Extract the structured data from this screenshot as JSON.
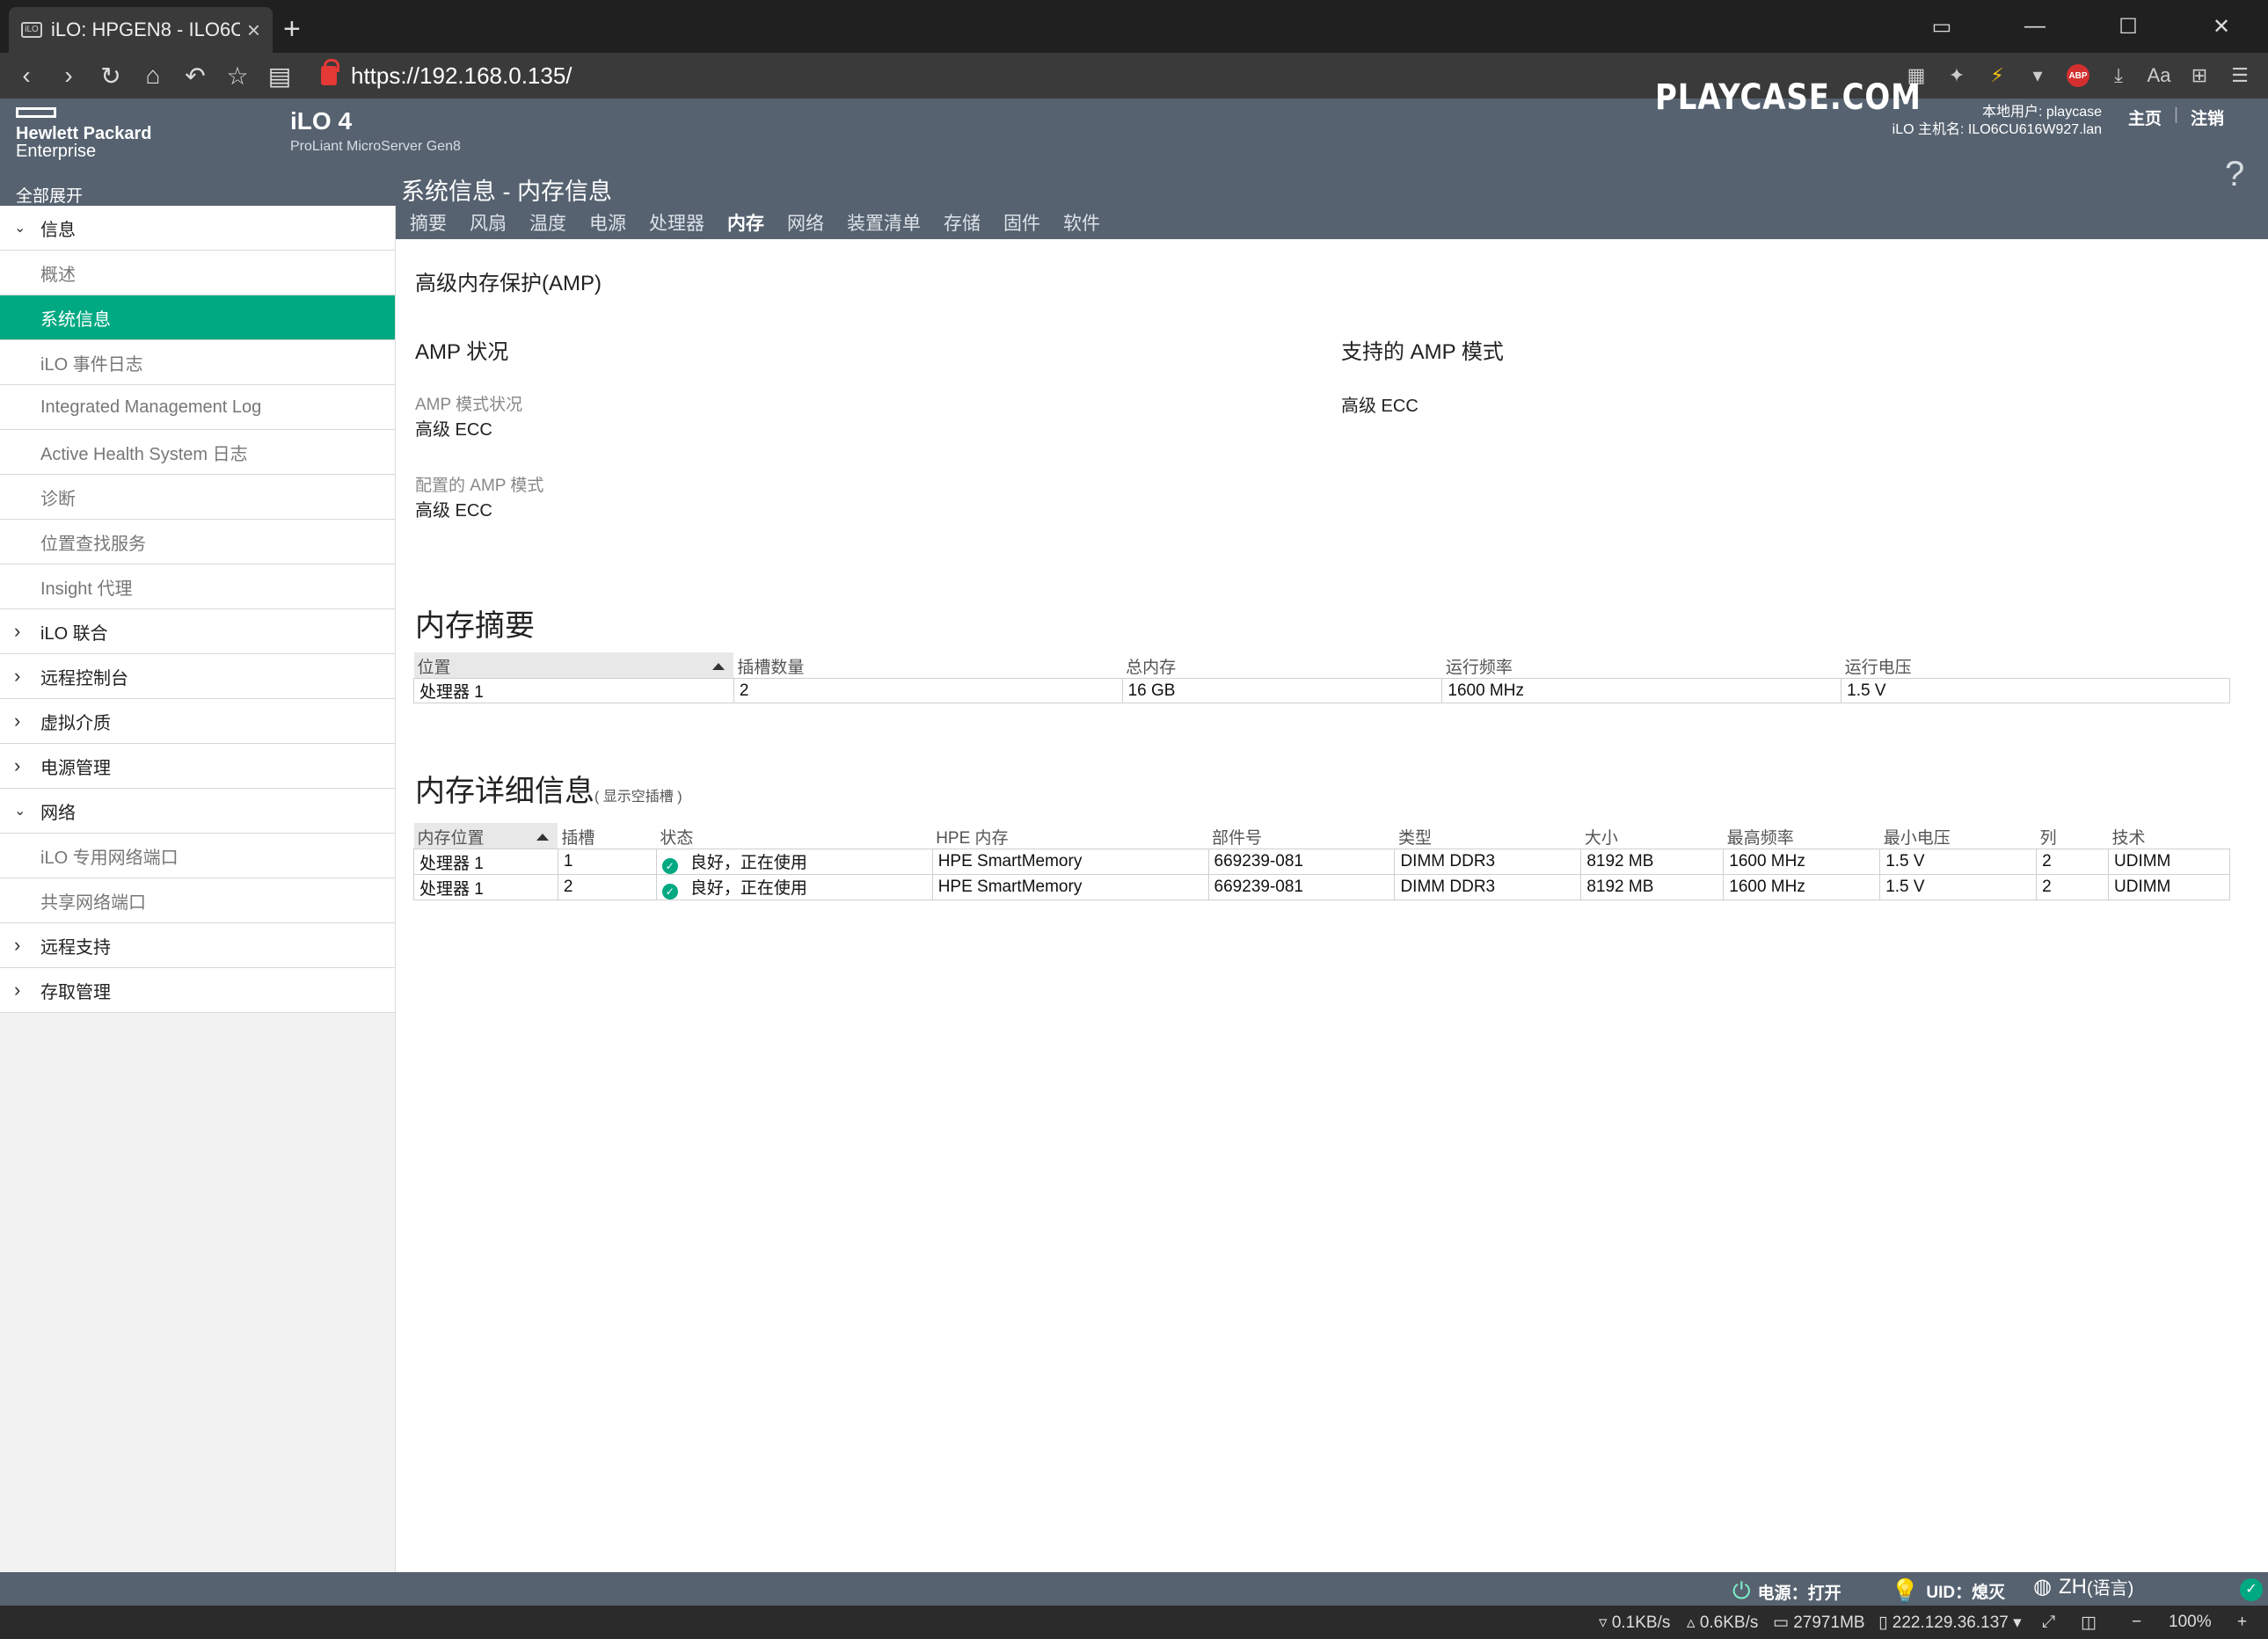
{
  "browser": {
    "tab_title": "iLO: HPGEN8 - ILO6CU6",
    "favicon_text": "iLO",
    "url": "https://192.168.0.135/",
    "status": {
      "down_speed": "0.1KB/s",
      "up_speed": "0.6KB/s",
      "memory": "27971MB",
      "ip": "222.129.36.137",
      "zoom": "100%"
    }
  },
  "header": {
    "vendor_line1": "Hewlett Packard",
    "vendor_line2": "Enterprise",
    "product": "iLO 4",
    "model": "ProLiant MicroServer Gen8",
    "watermark": "PLAYCASE.COM",
    "local_user": "本地用户: playcase",
    "hostname": "iLO 主机名:   ILO6CU616W927.lan",
    "home_link": "主页",
    "logout_link": "注销",
    "help": "?"
  },
  "nav": {
    "expand_all": "全部展开",
    "page_title": "系统信息 - 内存信息",
    "tabs": [
      "摘要",
      "风扇",
      "温度",
      "电源",
      "处理器",
      "内存",
      "网络",
      "装置清单",
      "存储",
      "固件",
      "软件"
    ],
    "active_tab": "内存"
  },
  "sidebar": {
    "items": [
      {
        "label": "信息",
        "type": "group",
        "expanded": true
      },
      {
        "label": "概述",
        "type": "child"
      },
      {
        "label": "系统信息",
        "type": "child",
        "active": true
      },
      {
        "label": "iLO 事件日志",
        "type": "child"
      },
      {
        "label": "Integrated Management Log",
        "type": "child"
      },
      {
        "label": "Active Health System 日志",
        "type": "child"
      },
      {
        "label": "诊断",
        "type": "child"
      },
      {
        "label": "位置查找服务",
        "type": "child"
      },
      {
        "label": "Insight 代理",
        "type": "child"
      },
      {
        "label": "iLO 联合",
        "type": "group"
      },
      {
        "label": "远程控制台",
        "type": "group"
      },
      {
        "label": "虚拟介质",
        "type": "group"
      },
      {
        "label": "电源管理",
        "type": "group"
      },
      {
        "label": "网络",
        "type": "group",
        "expanded": true
      },
      {
        "label": "iLO 专用网络端口",
        "type": "child"
      },
      {
        "label": "共享网络端口",
        "type": "child"
      },
      {
        "label": "远程支持",
        "type": "group"
      },
      {
        "label": "存取管理",
        "type": "group"
      }
    ]
  },
  "amp": {
    "section_title": "高级内存保护(AMP)",
    "status_title": "AMP 状况",
    "mode_status_label": "AMP 模式状况",
    "mode_status_value": "高级 ECC",
    "configured_label": "配置的 AMP 模式",
    "configured_value": "高级 ECC",
    "supported_title": "支持的 AMP 模式",
    "supported_value": "高级 ECC"
  },
  "summary": {
    "title": "内存摘要",
    "columns": [
      "位置",
      "插槽数量",
      "总内存",
      "运行频率",
      "运行电压"
    ],
    "rows": [
      [
        "处理器 1",
        "2",
        "16 GB",
        "1600 MHz",
        "1.5 V"
      ]
    ]
  },
  "details": {
    "title": "内存详细信息",
    "show_empty": "( 显示空插槽 )",
    "columns": [
      "内存位置",
      "插槽",
      "状态",
      "HPE 内存",
      "部件号",
      "类型",
      "大小",
      "最高频率",
      "最小电压",
      "列",
      "技术"
    ],
    "rows": [
      [
        "处理器 1",
        "1",
        "良好，正在使用",
        "HPE SmartMemory",
        "669239-081",
        "DIMM DDR3",
        "8192 MB",
        "1600 MHz",
        "1.5 V",
        "2",
        "UDIMM"
      ],
      [
        "处理器 1",
        "2",
        "良好，正在使用",
        "HPE SmartMemory",
        "669239-081",
        "DIMM DDR3",
        "8192 MB",
        "1600 MHz",
        "1.5 V",
        "2",
        "UDIMM"
      ]
    ]
  },
  "footer": {
    "power": "电源：打开",
    "uid": "UID：熄灭",
    "lang": "ZH",
    "lang_suffix": "(语言)"
  },
  "colors": {
    "header_bg": "#566270",
    "accent": "#01a982"
  }
}
